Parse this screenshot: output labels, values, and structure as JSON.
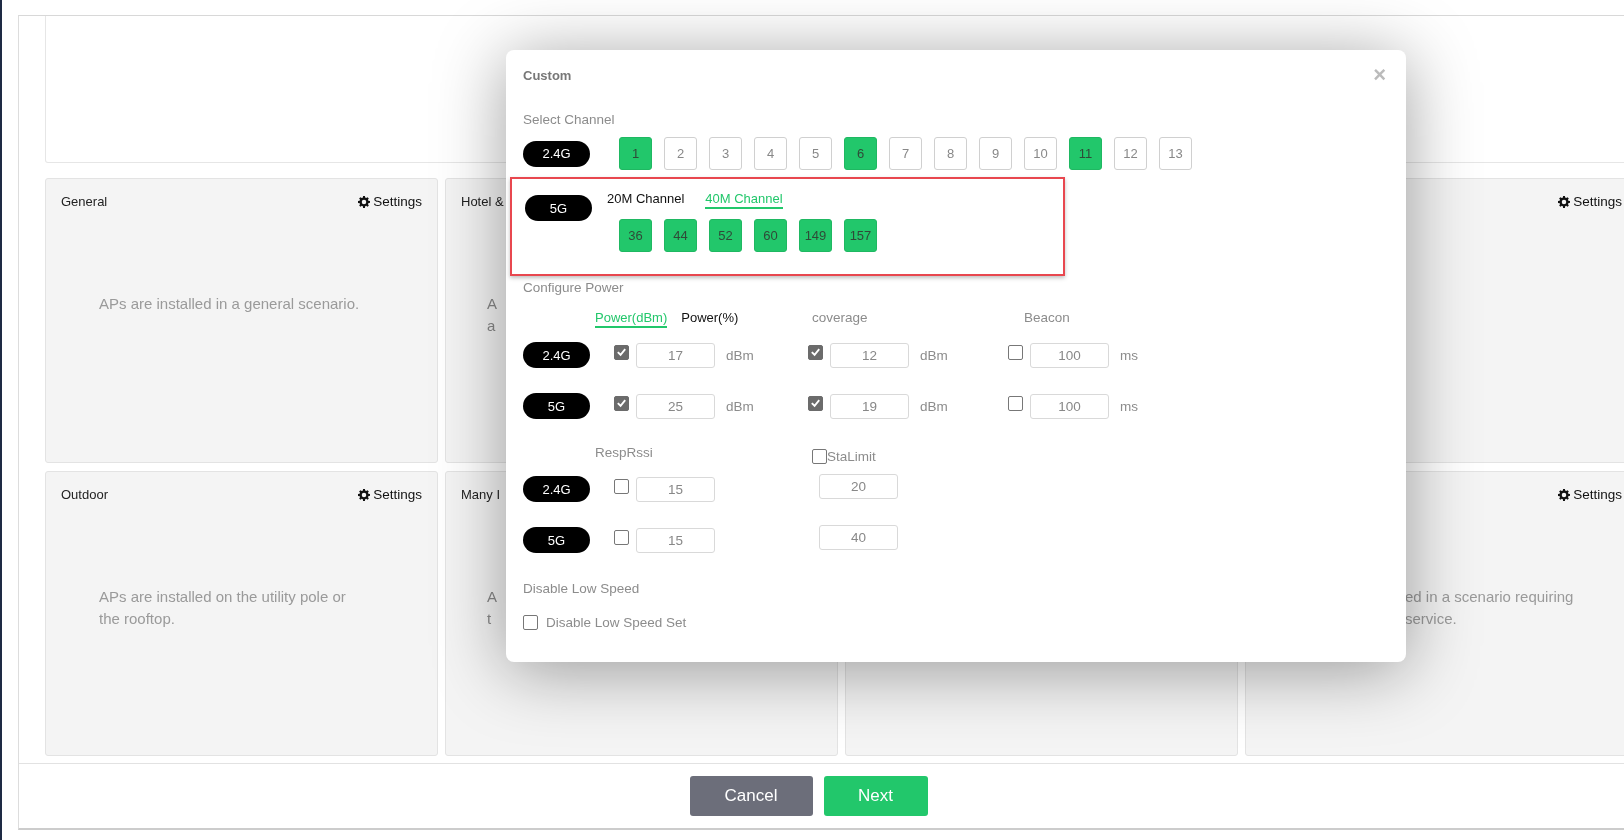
{
  "scenario_cards": [
    {
      "title": "General",
      "settings": "Settings",
      "description": [
        "APs are installed in a general scenario."
      ]
    },
    {
      "title": "Hotel &",
      "description": [
        "A",
        "a"
      ]
    },
    {
      "settings": "Settings"
    },
    {
      "title": "Outdoor",
      "settings": "Settings",
      "description": [
        "APs are installed on the utility pole or",
        "the rooftop."
      ]
    },
    {
      "title": "Many I",
      "description": [
        "A",
        "t"
      ]
    },
    {
      "settings": "Settings",
      "description": [
        "ed in a scenario requiring",
        "service."
      ]
    }
  ],
  "dialog": {
    "title": "Custom",
    "close": "×",
    "select_channel": {
      "label": "Select Channel",
      "band_24": {
        "band": "2.4G",
        "channels": [
          {
            "label": "1",
            "selected": true
          },
          {
            "label": "2",
            "selected": false
          },
          {
            "label": "3",
            "selected": false
          },
          {
            "label": "4",
            "selected": false
          },
          {
            "label": "5",
            "selected": false
          },
          {
            "label": "6",
            "selected": true
          },
          {
            "label": "7",
            "selected": false
          },
          {
            "label": "8",
            "selected": false
          },
          {
            "label": "9",
            "selected": false
          },
          {
            "label": "10",
            "selected": false
          },
          {
            "label": "11",
            "selected": true
          },
          {
            "label": "12",
            "selected": false
          },
          {
            "label": "13",
            "selected": false
          }
        ]
      },
      "band_5": {
        "band": "5G",
        "highlighted": true,
        "tabs": [
          {
            "label": "20M Channel",
            "selected": false
          },
          {
            "label": "40M Channel",
            "selected": true
          }
        ],
        "channels": [
          {
            "label": "36",
            "selected": true
          },
          {
            "label": "44",
            "selected": true
          },
          {
            "label": "52",
            "selected": true
          },
          {
            "label": "60",
            "selected": true
          },
          {
            "label": "149",
            "selected": true
          },
          {
            "label": "157",
            "selected": true
          }
        ]
      }
    },
    "configure_power": {
      "label": "Configure Power",
      "tabs": [
        {
          "label": "Power(dBm)",
          "selected": true
        },
        {
          "label": "Power(%)",
          "selected": false
        }
      ],
      "coverage_label": "coverage",
      "beacon_label": "Beacon",
      "rows": [
        {
          "band": "2.4G",
          "power": {
            "checked": true,
            "value": "17",
            "unit": "dBm"
          },
          "coverage": {
            "checked": true,
            "value": "12",
            "unit": "dBm"
          },
          "beacon": {
            "checked": false,
            "value": "100",
            "unit": "ms"
          }
        },
        {
          "band": "5G",
          "power": {
            "checked": true,
            "value": "25",
            "unit": "dBm"
          },
          "coverage": {
            "checked": true,
            "value": "19",
            "unit": "dBm"
          },
          "beacon": {
            "checked": false,
            "value": "100",
            "unit": "ms"
          }
        }
      ]
    },
    "resp_rssi": {
      "label": "RespRssi",
      "sta_limit": {
        "label": "StaLimit",
        "checked": false
      },
      "rows": [
        {
          "band": "2.4G",
          "checked": false,
          "value": "15",
          "sta_limit": "20"
        },
        {
          "band": "5G",
          "checked": false,
          "value": "15",
          "sta_limit": "40"
        }
      ]
    },
    "low_speed": {
      "label": "Disable Low Speed",
      "option": {
        "label": "Disable Low Speed Set",
        "checked": false
      }
    }
  },
  "footer": {
    "buttons": [
      {
        "label": "Cancel",
        "kind": "secondary"
      },
      {
        "label": "Next",
        "kind": "primary"
      }
    ]
  }
}
